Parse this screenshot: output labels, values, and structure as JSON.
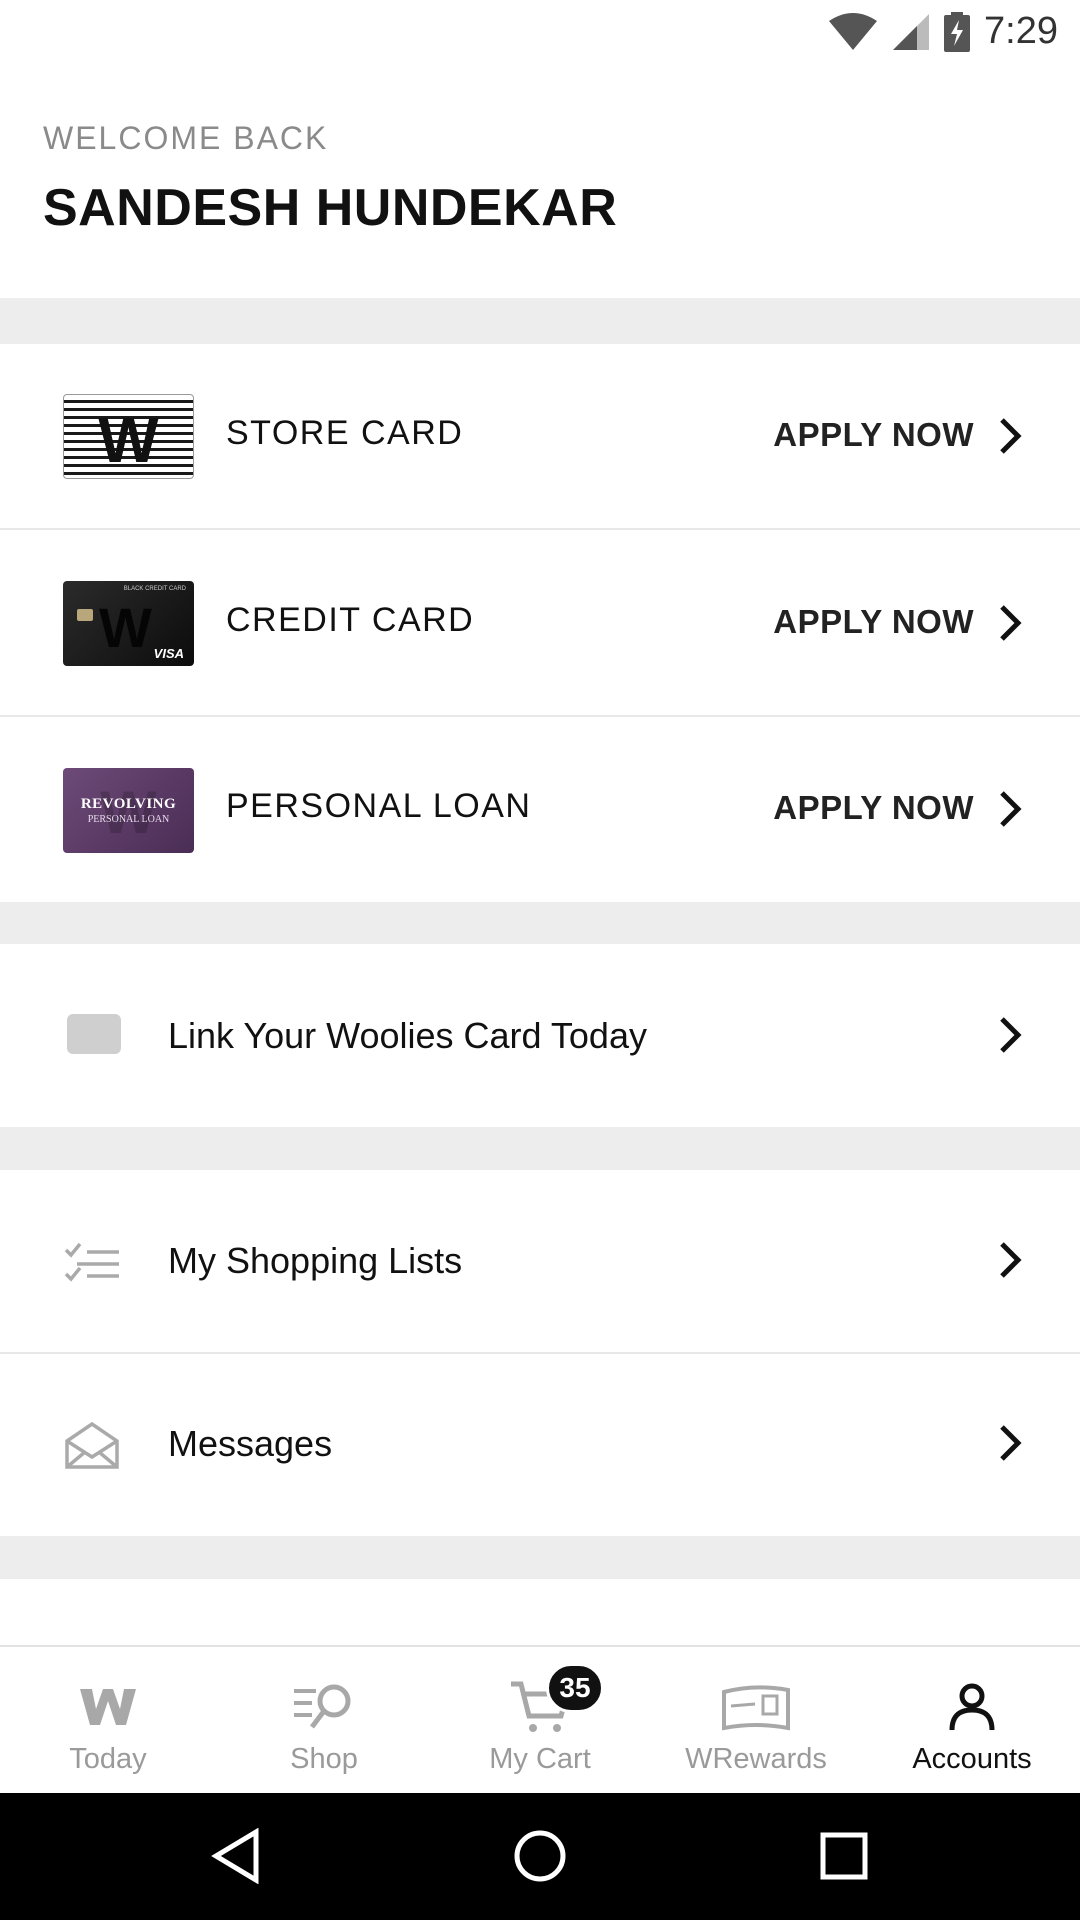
{
  "status_bar": {
    "time": "7:29",
    "icons": [
      "wifi-icon",
      "signal-icon",
      "battery-charging-icon"
    ]
  },
  "header": {
    "welcome": "WELCOME BACK",
    "name": "SANDESH HUNDEKAR"
  },
  "products": [
    {
      "label": "STORE CARD",
      "action": "APPLY NOW",
      "thumb": "store-card"
    },
    {
      "label": "CREDIT CARD",
      "action": "APPLY NOW",
      "thumb": "credit-card"
    },
    {
      "label": "PERSONAL LOAN",
      "action": "APPLY NOW",
      "thumb": "personal-loan"
    }
  ],
  "thumb_text": {
    "store": "W",
    "credit_top": "BLACK CREDIT CARD",
    "credit_visa": "VISA",
    "loan_line1": "REVOLVING",
    "loan_line2": "PERSONAL LOAN"
  },
  "link_card": {
    "label": "Link Your Woolies Card Today",
    "icon": "card-icon"
  },
  "menu": [
    {
      "label": "My Shopping Lists",
      "icon": "checklist-icon"
    },
    {
      "label": "Messages",
      "icon": "envelope-icon"
    }
  ],
  "bottom_nav": [
    {
      "label": "Today",
      "icon": "w-logo-icon",
      "active": false
    },
    {
      "label": "Shop",
      "icon": "search-list-icon",
      "active": false
    },
    {
      "label": "My Cart",
      "icon": "cart-icon",
      "active": false,
      "badge": "35"
    },
    {
      "label": "WRewards",
      "icon": "rewards-card-icon",
      "active": false
    },
    {
      "label": "Accounts",
      "icon": "person-icon",
      "active": true
    }
  ],
  "system_nav": [
    "back-icon",
    "home-icon",
    "recents-icon"
  ],
  "colors": {
    "divider": "#ededed",
    "inactive": "#9a9a9a",
    "active": "#111111",
    "loan_purple": "#5b3a66"
  }
}
